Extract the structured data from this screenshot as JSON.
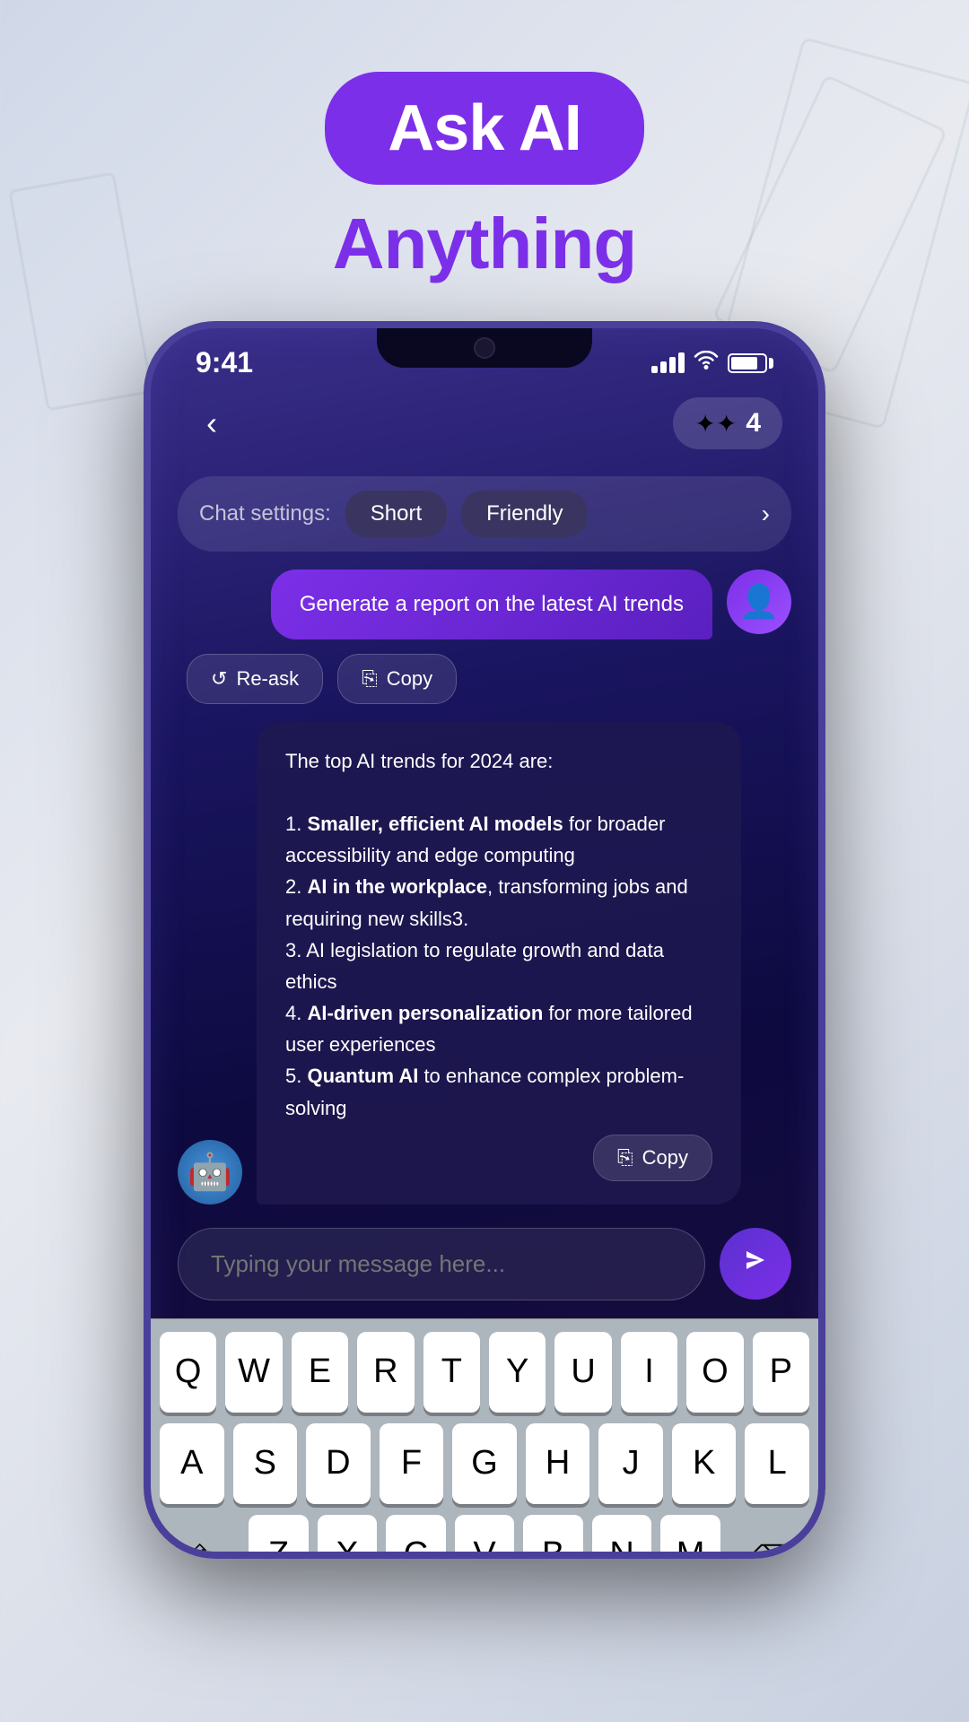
{
  "header": {
    "title_line1": "Ask AI",
    "title_line2": "Anything",
    "badge_text": "Ask AI"
  },
  "status_bar": {
    "time": "9:41",
    "signal": "signal",
    "wifi": "wifi",
    "battery": "battery"
  },
  "nav": {
    "back_label": "‹",
    "credits_icon": "✦",
    "credits_count": "4"
  },
  "chat_settings": {
    "label": "Chat settings:",
    "chip1": "Short",
    "chip2": "Friendly",
    "arrow": "›"
  },
  "user_message": {
    "text": "Generate a report on the latest AI trends"
  },
  "action_buttons": {
    "reask_label": "Re-ask",
    "copy_label": "Copy",
    "reask_icon": "↺",
    "copy_icon": "⎘"
  },
  "ai_response": {
    "intro": "The top AI trends for 2024 are:",
    "items": [
      {
        "number": "1.",
        "bold": "Smaller, efficient AI models",
        "rest": " for broader accessibility and edge computing"
      },
      {
        "number": "2.",
        "bold": "AI in the workplace",
        "rest": ", transforming jobs and requiring new skills3."
      },
      {
        "number": "3.",
        "bold": "",
        "rest": "AI legislation to regulate growth and data ethics"
      },
      {
        "number": "4.",
        "bold": "AI-driven personalization",
        "rest": " for more tailored user experiences"
      },
      {
        "number": "5.",
        "bold": "Quantum AI",
        "rest": " to enhance complex problem-solving"
      }
    ],
    "copy_button": "Copy",
    "copy_icon": "⎘"
  },
  "input": {
    "placeholder": "Typing your message here..."
  },
  "keyboard": {
    "rows": [
      [
        "Q",
        "W",
        "E",
        "R",
        "T",
        "Y",
        "U",
        "I",
        "O",
        "P"
      ],
      [
        "A",
        "S",
        "D",
        "F",
        "G",
        "H",
        "J",
        "K",
        "L"
      ],
      [
        "⇧",
        "Z",
        "X",
        "C",
        "V",
        "B",
        "N",
        "M",
        "⌫"
      ]
    ]
  }
}
